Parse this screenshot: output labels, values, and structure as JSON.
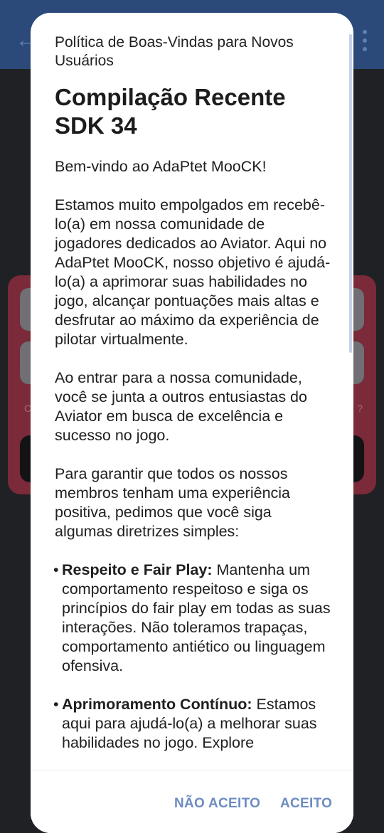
{
  "background_app": {
    "back_icon": "arrow-left-icon",
    "menu_icon": "more-vert-icon",
    "link_left": "C",
    "link_right": "?"
  },
  "dialog": {
    "title": "Política de Boas-Vindas para Novos Usuários",
    "heading": "Compilação Recente SDK 34",
    "paragraphs": [
      "Bem-vindo ao AdaPtet MooCK!",
      "Estamos muito empolgados em recebê-lo(a) em nossa comunidade de jogadores dedicados ao Aviator. Aqui no AdaPtet MooCK, nosso objetivo é ajudá-lo(a) a aprimorar suas habilidades no jogo, alcançar pontuações mais altas e desfrutar ao máximo da experiência de pilotar virtualmente.",
      "Ao entrar para a nossa comunidade, você se junta a outros entusiastas do Aviator em busca de excelência e sucesso no jogo.",
      "Para garantir que todos os nossos membros tenham uma experiência positiva, pedimos que você siga algumas diretrizes simples:"
    ],
    "bullets": [
      {
        "title": "Respeito e Fair Play:",
        "text": " Mantenha um comportamento respeitoso e siga os princípios do fair play em todas as suas interações. Não toleramos trapaças, comportamento antiético ou linguagem ofensiva."
      },
      {
        "title": "Aprimoramento Contínuo:",
        "text": " Estamos aqui para ajudá-lo(a) a melhorar suas habilidades no jogo. Explore"
      }
    ],
    "bullet_symbol": "•",
    "decline_label": "NÃO ACEITO",
    "accept_label": "ACEITO"
  },
  "colors": {
    "app_bar": "#2c4a79",
    "accent": "#6d8cc0",
    "background_card": "#7a2a38"
  }
}
